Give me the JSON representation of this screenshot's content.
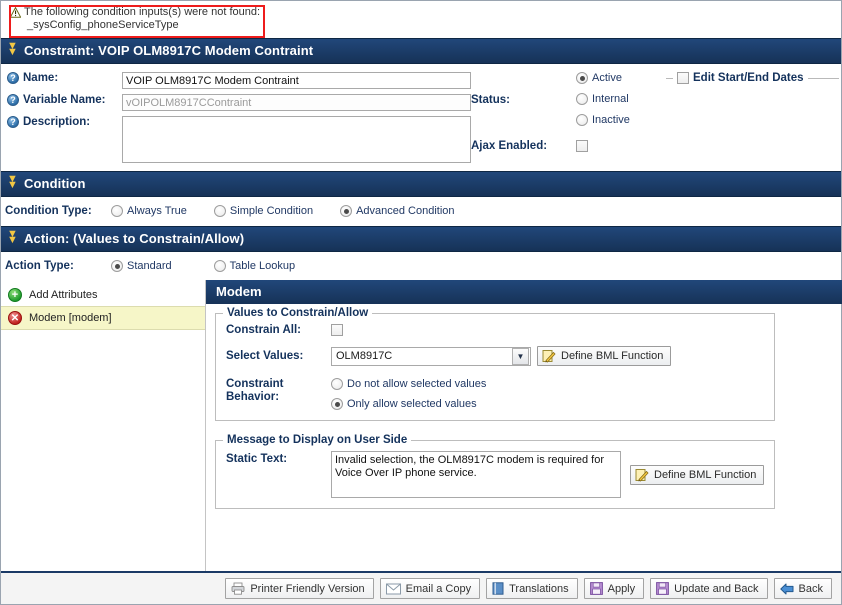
{
  "error": {
    "icon": "warning-triangle-icon",
    "message": "The following condition inputs(s) were not found:",
    "detail": "_sysConfig_phoneServiceType"
  },
  "constraint_section": {
    "title": "Constraint: VOIP OLM8917C Modem Contraint",
    "collapse_icon": "chevron-double-down-icon",
    "fields": {
      "name_label": "Name:",
      "name_value": "VOIP OLM8917C Modem Contraint",
      "variable_name_label": "Variable Name:",
      "variable_name_value": "vOIPOLM8917CContraint",
      "description_label": "Description:",
      "description_value": ""
    },
    "status_label": "Status:",
    "status_options": [
      "Active",
      "Internal",
      "Inactive"
    ],
    "status_selected": "Active",
    "ajax_label": "Ajax Enabled:",
    "ajax_checked": false,
    "dates_legend": "Edit Start/End Dates",
    "dates_checked": false
  },
  "condition_section": {
    "title": "Condition",
    "collapse_icon": "chevron-double-down-icon",
    "type_label": "Condition Type:",
    "type_options": [
      "Always True",
      "Simple Condition",
      "Advanced Condition"
    ],
    "type_selected": "Advanced Condition"
  },
  "action_section": {
    "title": "Action: (Values to Constrain/Allow)",
    "collapse_icon": "chevron-double-down-icon",
    "action_type_label": "Action Type:",
    "action_type_options": [
      "Standard",
      "Table Lookup"
    ],
    "action_type_selected": "Standard",
    "sidebar": {
      "add_label": "Add Attributes",
      "add_icon": "plus-circle-icon",
      "items": [
        {
          "label": "Modem [modem]",
          "icon": "delete-circle-icon",
          "selected": true
        }
      ]
    },
    "panel": {
      "title": "Modem",
      "values_group": {
        "title": "Values to Constrain/Allow",
        "constrain_all_label": "Constrain All:",
        "constrain_all_checked": false,
        "select_values_label": "Select Values:",
        "select_values_value": "OLM8917C",
        "bml_button_label": "Define BML Function",
        "bml_button_icon": "pencil-note-icon",
        "behavior_label_line1": "Constraint",
        "behavior_label_line2": "Behavior:",
        "behavior_options": [
          "Do not allow selected values",
          "Only allow selected values"
        ],
        "behavior_selected": "Only allow selected values"
      },
      "message_group": {
        "title": "Message to Display on User Side",
        "static_text_label": "Static Text:",
        "static_text_value": "Invalid selection, the OLM8917C modem is required for Voice Over IP phone service.",
        "bml_button_label": "Define BML Function",
        "bml_button_icon": "pencil-note-icon"
      }
    }
  },
  "footer": {
    "buttons": [
      {
        "label": "Printer Friendly Version",
        "icon": "printer-icon"
      },
      {
        "label": "Email a Copy",
        "icon": "envelope-icon"
      },
      {
        "label": "Translations",
        "icon": "book-icon"
      },
      {
        "label": "Apply",
        "icon": "save-icon"
      },
      {
        "label": "Update and Back",
        "icon": "save-icon"
      },
      {
        "label": "Back",
        "icon": "arrow-left-icon"
      }
    ]
  },
  "colors": {
    "header_navy": "#1b3a66",
    "accent_gold": "#f2c744",
    "error_red": "#ee1c1c",
    "selected_row": "#f6f6c8"
  }
}
